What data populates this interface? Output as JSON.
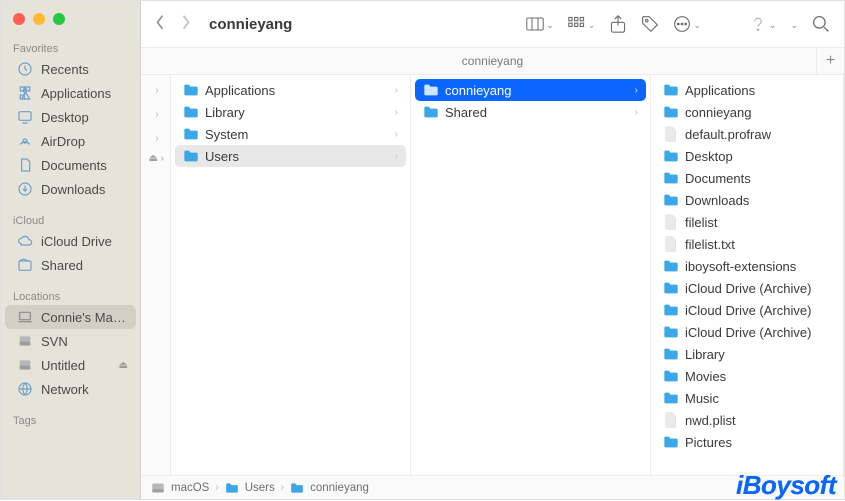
{
  "window_title": "connieyang",
  "tab_title": "connieyang",
  "sidebar": {
    "sections": [
      {
        "title": "Favorites",
        "items": [
          {
            "icon": "recents",
            "label": "Recents"
          },
          {
            "icon": "applications",
            "label": "Applications"
          },
          {
            "icon": "desktop",
            "label": "Desktop"
          },
          {
            "icon": "airdrop",
            "label": "AirDrop"
          },
          {
            "icon": "documents",
            "label": "Documents"
          },
          {
            "icon": "downloads",
            "label": "Downloads"
          }
        ]
      },
      {
        "title": "iCloud",
        "items": [
          {
            "icon": "icloud",
            "label": "iCloud Drive"
          },
          {
            "icon": "shared",
            "label": "Shared"
          }
        ]
      },
      {
        "title": "Locations",
        "items": [
          {
            "icon": "laptop",
            "label": "Connie's Ma…",
            "selected": true
          },
          {
            "icon": "disk",
            "label": "SVN"
          },
          {
            "icon": "disk",
            "label": "Untitled",
            "eject": true
          },
          {
            "icon": "network",
            "label": "Network"
          }
        ]
      },
      {
        "title": "Tags",
        "items": []
      }
    ]
  },
  "columns": [
    {
      "items": [
        {
          "type": "folder",
          "label": "Applications",
          "chev": true
        },
        {
          "type": "folder",
          "label": "Library",
          "chev": true
        },
        {
          "type": "folder",
          "label": "System",
          "chev": true
        },
        {
          "type": "folder",
          "label": "Users",
          "chev": true,
          "sel": "grey"
        }
      ]
    },
    {
      "items": [
        {
          "type": "folder",
          "label": "connieyang",
          "chev": true,
          "sel": "blue"
        },
        {
          "type": "folder",
          "label": "Shared",
          "chev": true
        }
      ]
    },
    {
      "items": [
        {
          "type": "folder",
          "label": "Applications"
        },
        {
          "type": "folder",
          "label": "connieyang"
        },
        {
          "type": "file",
          "label": "default.profraw"
        },
        {
          "type": "folder",
          "label": "Desktop"
        },
        {
          "type": "folder",
          "label": "Documents"
        },
        {
          "type": "folder",
          "label": "Downloads"
        },
        {
          "type": "file",
          "label": "filelist"
        },
        {
          "type": "file",
          "label": "filelist.txt"
        },
        {
          "type": "folder",
          "label": "iboysoft-extensions"
        },
        {
          "type": "folder",
          "label": "iCloud Drive (Archive)"
        },
        {
          "type": "folder",
          "label": "iCloud Drive (Archive)"
        },
        {
          "type": "folder",
          "label": "iCloud Drive (Archive)"
        },
        {
          "type": "folder",
          "label": "Library"
        },
        {
          "type": "folder",
          "label": "Movies"
        },
        {
          "type": "folder",
          "label": "Music"
        },
        {
          "type": "file",
          "label": "nwd.plist"
        },
        {
          "type": "folder",
          "label": "Pictures"
        }
      ]
    }
  ],
  "path": [
    {
      "icon": "disk",
      "label": "macOS"
    },
    {
      "icon": "folder",
      "label": "Users"
    },
    {
      "icon": "folder",
      "label": "connieyang"
    }
  ],
  "watermark": "iBoysoft"
}
